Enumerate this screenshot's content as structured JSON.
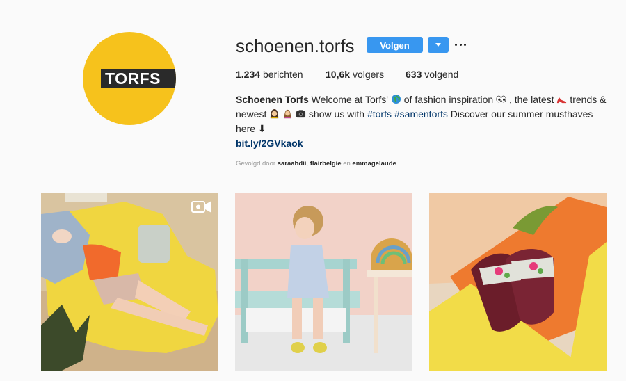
{
  "profile": {
    "username": "schoenen.torfs",
    "avatar_text": "TORFS",
    "follow_label": "Volgen",
    "more_label": "...",
    "stats": {
      "posts_count": "1.234",
      "posts_label": "berichten",
      "followers_count": "10,6k",
      "followers_label": "volgers",
      "following_count": "633",
      "following_label": "volgend"
    },
    "bio": {
      "name": "Schoenen Torfs",
      "text1": " Welcome at Torfs'",
      "text2": " of fashion inspiration",
      "text3": " , the latest",
      "text4": " trends & newest",
      "text5": " show us with ",
      "hashtag1": "#torfs",
      "hashtag2": "#samentorfs",
      "text6": " Discover our summer musthaves here ⬇",
      "link": "bit.ly/2GVkaok"
    },
    "followed_by": {
      "prefix": "Gevolgd door ",
      "user1": "saraahdii",
      "sep": ", ",
      "user2": "flairbelgie",
      "and": " en ",
      "user3": "emmagelaude"
    }
  },
  "colors": {
    "accent": "#3897f0",
    "avatar_bg": "#f6c21c",
    "link": "#003569"
  },
  "icons": {
    "video": "video-camera-icon"
  }
}
